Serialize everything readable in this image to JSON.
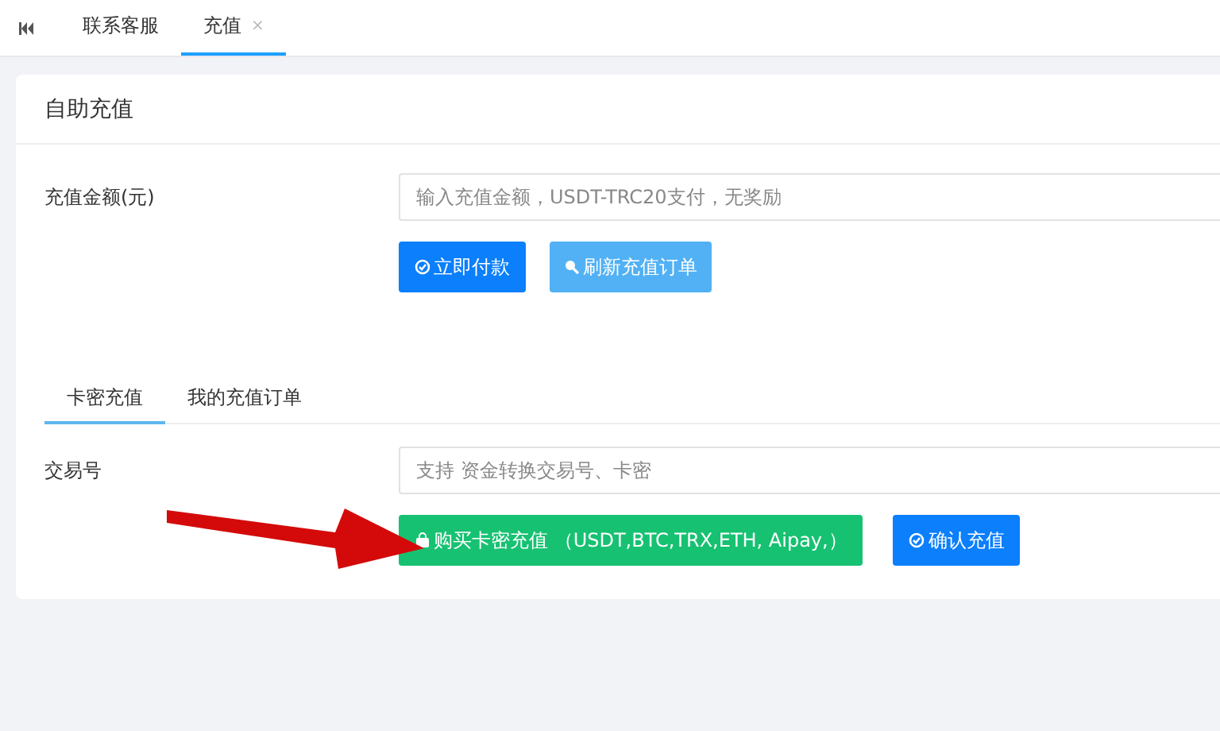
{
  "top_tabs": [
    {
      "label": "联系客服",
      "selected": false
    },
    {
      "label": "充值",
      "selected": true,
      "close": "×"
    }
  ],
  "card": {
    "title": "自助充值",
    "amount_field": {
      "label": "充值金额(元)",
      "placeholder": "输入充值金额，USDT-TRC20支付，无奖励"
    },
    "amount_buttons": [
      {
        "kind": "pay",
        "label": "立即付款"
      },
      {
        "kind": "refresh",
        "label": "刷新充值订单"
      }
    ],
    "sub_tabs": [
      {
        "label": "卡密充值",
        "selected": true
      },
      {
        "label": "我的充值订单",
        "selected": false
      }
    ],
    "txn_field": {
      "label": "交易号",
      "placeholder": "支持 资金转换交易号、卡密"
    },
    "txn_buttons": [
      {
        "kind": "buy",
        "label": "购买卡密充值 （USDT,BTC,TRX,ETH, Aipay,）"
      },
      {
        "kind": "confirm",
        "label": "确认充值"
      }
    ]
  },
  "annotation": {
    "kind": "arrow"
  }
}
